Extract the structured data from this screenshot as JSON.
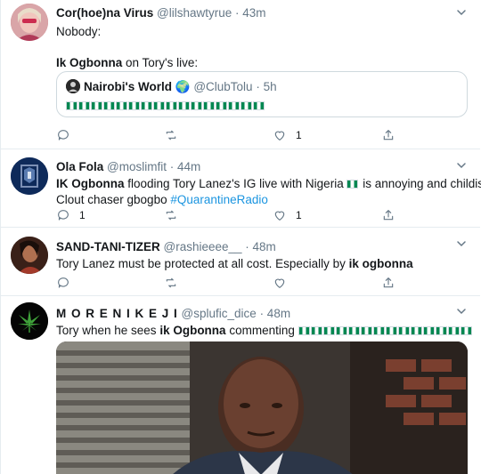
{
  "tweets": [
    {
      "name": "Cor(hoe)na Virus",
      "handle": "@lilshawtyrue",
      "time": "· 43m",
      "line1": "Nobody:",
      "line2_bold": "Ik Ogbonna",
      "line2_rest": " on Tory's live:",
      "quote": {
        "name": "Nairobi's World",
        "emoji": "🌍",
        "handle": "@ClubTolu",
        "time": "· 5h",
        "flag_count": 16
      },
      "actions": {
        "reply": "",
        "retweet": "",
        "like": "1"
      }
    },
    {
      "name": "Ola Fola",
      "handle": "@moslimfit",
      "time": "· 44m",
      "text_bold": "IK Ogbonna",
      "text_a": " flooding Tory Lanez's IG live with Nigeria ",
      "text_b": " is annoying and childish.",
      "text_line2": "Clout chaser gbogbo ",
      "hashtag": "#QuarantineRadio",
      "actions": {
        "reply": "1",
        "retweet": "",
        "like": "1"
      }
    },
    {
      "name": "SAND-TANI-TIZER",
      "handle": "@rashieeee__",
      "time": "· 48m",
      "text_a": "Tory Lanez must be protected at all cost. Especially by ",
      "text_bold": "ik ogbonna",
      "actions": {
        "reply": "",
        "retweet": "",
        "like": ""
      }
    },
    {
      "name": "M O R E N I K E J I",
      "handle": "@splufic_dice",
      "time": "· 48m",
      "text_a": "Tory when he sees ",
      "text_bold": "ik Ogbonna",
      "text_b": " commenting ",
      "flag_count": 14
    }
  ],
  "colors": {
    "flag_green": "#008751",
    "link_blue": "#1b95e0",
    "muted_gray": "#657786",
    "divider": "#e6ecf0"
  }
}
